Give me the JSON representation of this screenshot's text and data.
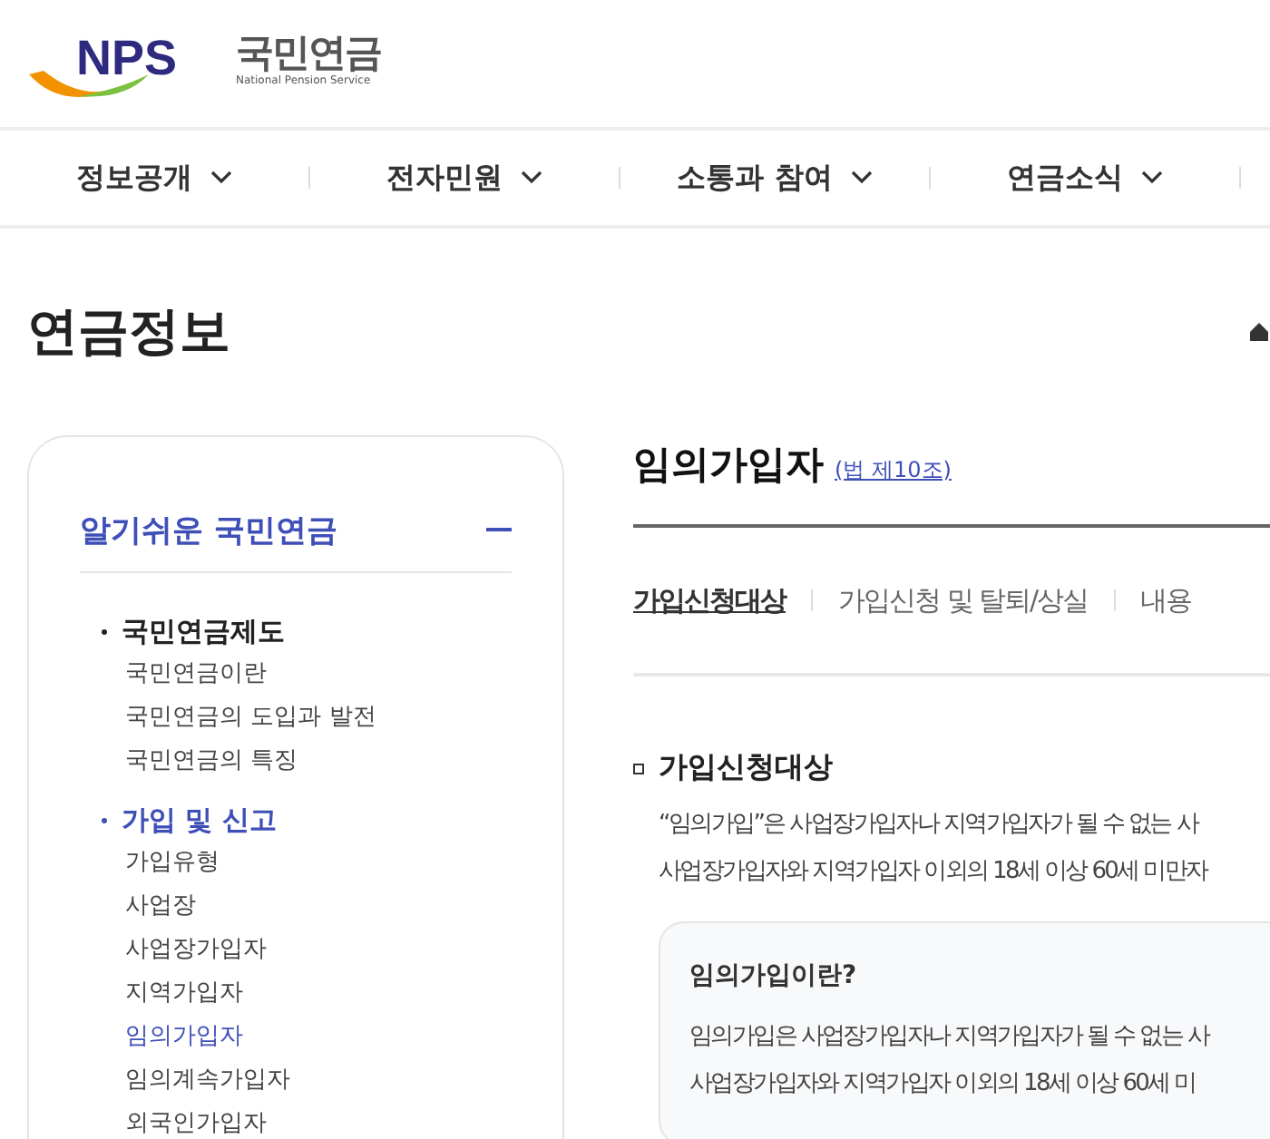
{
  "logo": {
    "name": "국민연금",
    "subtitle": "National Pension Service",
    "mark": "NPS"
  },
  "nav": [
    {
      "label": "정보공개"
    },
    {
      "label": "전자민원"
    },
    {
      "label": "소통과 참여"
    },
    {
      "label": "연금소식"
    }
  ],
  "page_title": "연금정보",
  "sidebar": {
    "title": "알기쉬운 국민연금",
    "expanded": true,
    "groups": [
      {
        "label": "국민연금제도",
        "selected": false,
        "items": [
          {
            "label": "국민연금이란",
            "selected": false
          },
          {
            "label": "국민연금의 도입과 발전",
            "selected": false
          },
          {
            "label": "국민연금의 특징",
            "selected": false
          }
        ]
      },
      {
        "label": "가입 및 신고",
        "selected": true,
        "items": [
          {
            "label": "가입유형",
            "selected": false
          },
          {
            "label": "사업장",
            "selected": false
          },
          {
            "label": "사업장가입자",
            "selected": false
          },
          {
            "label": "지역가입자",
            "selected": false
          },
          {
            "label": "임의가입자",
            "selected": true
          },
          {
            "label": "임의계속가입자",
            "selected": false
          },
          {
            "label": "외국인가입자",
            "selected": false
          }
        ]
      }
    ]
  },
  "content": {
    "title": "임의가입자",
    "law_link": "(법 제10조)",
    "tabs": [
      {
        "label": "가입신청대상",
        "selected": true
      },
      {
        "label": "가입신청 및 탈퇴/상실",
        "selected": false
      },
      {
        "label": "내용",
        "selected": false
      }
    ],
    "section_title": "가입신청대상",
    "paragraph": [
      "“임의가입”은 사업장가입자나 지역가입자가 될 수 없는 사",
      "사업장가입자와 지역가입자 이외의 18세 이상 60세 미만자"
    ],
    "info_box": {
      "title": "임의가입이란?",
      "lines": [
        "임의가입은 사업장가입자나 지역가입자가 될 수 없는 사",
        "사업장가입자와 지역가입자 이외의 18세 이상 60세 미"
      ]
    }
  }
}
